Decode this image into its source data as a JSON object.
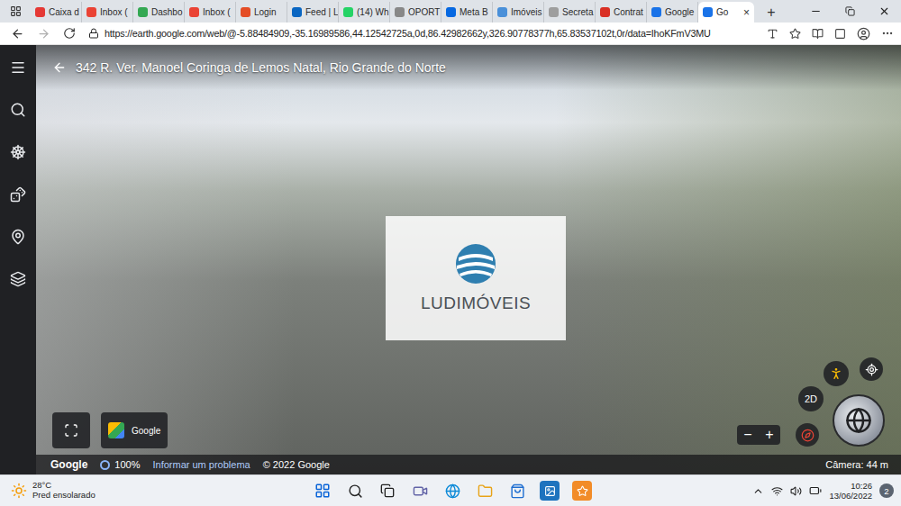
{
  "browser": {
    "tabs": [
      {
        "label": "Caixa d",
        "selected": false,
        "color": "#e53935"
      },
      {
        "label": "Inbox (",
        "selected": false,
        "color": "#ea4335"
      },
      {
        "label": "Dashbo",
        "selected": false,
        "color": "#34a853"
      },
      {
        "label": "Inbox (",
        "selected": false,
        "color": "#ea4335"
      },
      {
        "label": "Login",
        "selected": false,
        "color": "#e44d26"
      },
      {
        "label": "Feed | L",
        "selected": false,
        "color": "#0a66c2"
      },
      {
        "label": "(14) Wh",
        "selected": false,
        "color": "#25d366"
      },
      {
        "label": "OPORT",
        "selected": false,
        "color": "#888888"
      },
      {
        "label": "Meta B",
        "selected": false,
        "color": "#0668e1"
      },
      {
        "label": "Imóveis",
        "selected": false,
        "color": "#4a90d9"
      },
      {
        "label": "Secreta",
        "selected": false,
        "color": "#9e9e9e"
      },
      {
        "label": "Contrat",
        "selected": false,
        "color": "#d93025"
      },
      {
        "label": "Google",
        "selected": false,
        "color": "#1a73e8"
      },
      {
        "label": "Go",
        "selected": true,
        "color": "#1a73e8"
      }
    ],
    "close_tab": "×",
    "new_tab": "+",
    "url": "https://earth.google.com/web/@-5.88484909,-35.16989586,44.12542725a,0d,86.42982662y,326.90778377h,65.83537102t,0r/data=IhoKFmV3MU"
  },
  "viewer": {
    "location_title": "342 R. Ver. Manoel Coringa de Lemos Natal, Rio Grande do Norte",
    "watermark": "LUDIMÓVEIS",
    "thumbnail_label": "Google",
    "view_mode": "2D",
    "zoom_out": "−",
    "zoom_in": "+",
    "status_bar": {
      "logo": "Google",
      "zoom": "100%",
      "report": "Informar um problema",
      "copyright": "© 2022 Google",
      "camera": "Câmera: 44 m"
    }
  },
  "taskbar": {
    "weather": {
      "temp": "28°C",
      "condition": "Pred ensolarado"
    },
    "time": "10:26",
    "date": "13/06/2022",
    "notifications": "2"
  }
}
